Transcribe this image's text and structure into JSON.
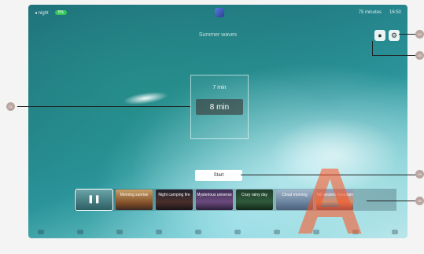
{
  "status_bar": {
    "left_items": [
      "◂ night",
      "5%"
    ],
    "right_items": [
      "75 minutes",
      "16:50"
    ]
  },
  "scene_title": "Summer waves",
  "timer": {
    "options": [
      "7 min",
      "8 min"
    ],
    "selected": "8 min"
  },
  "start_label": "Start",
  "scenes": [
    {
      "label": "Morning sunrise"
    },
    {
      "label": "Night camping fire"
    },
    {
      "label": "Mysterious universe"
    },
    {
      "label": "Cozy rainy day"
    },
    {
      "label": "Cloud morning"
    },
    {
      "label": "Tall ancient mountain"
    }
  ],
  "callouts": [
    "01",
    "02",
    "03",
    "04",
    "05"
  ],
  "watermark": "A",
  "icons": {
    "pause": "pause-icon",
    "record": "record-icon",
    "settings": "gear-icon"
  },
  "colors": {
    "status_pill": "#34c759",
    "watermark": "#ff5020",
    "callout": "#b9a6a1"
  }
}
